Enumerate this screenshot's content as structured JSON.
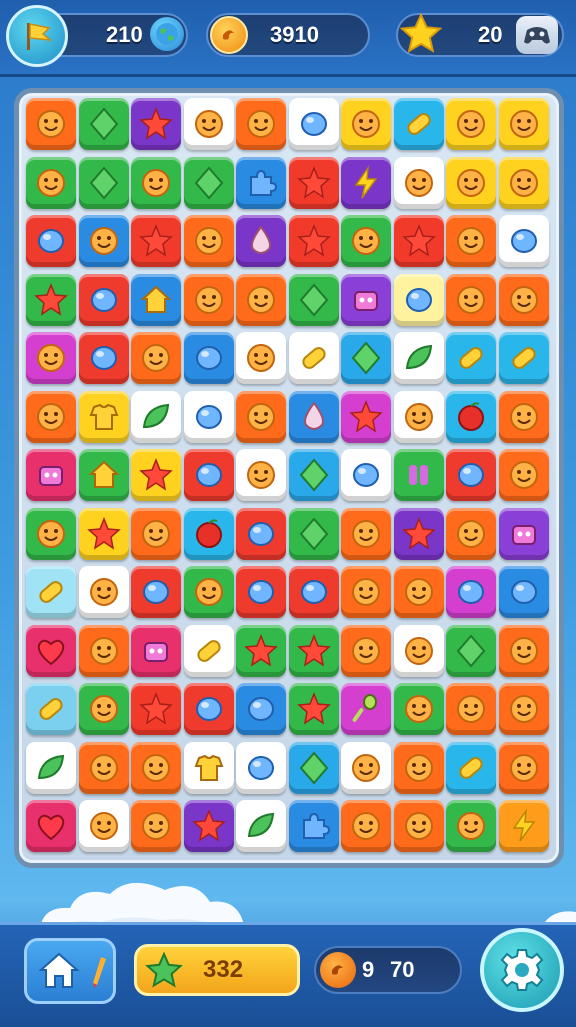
{
  "topbar": {
    "level": {
      "value": "210",
      "icon": "flag-icon",
      "badge_icon": "globe-icon"
    },
    "coins": {
      "value": "3910",
      "icon": "coin-icon"
    },
    "stars": {
      "value": "20",
      "icon": "star-icon",
      "badge_icon": "gamepad-icon"
    }
  },
  "bottombar": {
    "home": {
      "icon": "home-icon",
      "accent_icon": "pencil-icon"
    },
    "score": {
      "value": "332",
      "icon": "star-icon"
    },
    "coins": {
      "value": "9",
      "secondary": "70",
      "icon": "coin-icon"
    },
    "settings": {
      "icon": "gear-icon"
    }
  },
  "board": {
    "columns": 10,
    "rows": 13,
    "tiles": [
      [
        "orange-face",
        "green-diamond",
        "red-star",
        "white-face",
        "orange-face",
        "blue-gem",
        "yellow-face",
        "yellow-bar",
        "yellow-face",
        "yellow-face"
      ],
      [
        "green-face",
        "green-diamond",
        "green-face",
        "green-diamond",
        "blue-puzzle",
        "orange-star",
        "yellow-bolt",
        "white-face",
        "yellow-face",
        "yellow-face"
      ],
      [
        "red-gem",
        "blue-face",
        "orange-star",
        "orange-face",
        "white-drop",
        "orange-star",
        "green-face",
        "orange-star",
        "orange-face",
        "blue-gem"
      ],
      [
        "green-star",
        "red-gem",
        "yellow-house",
        "orange-face",
        "orange-face",
        "green-diamond",
        "purple-robot",
        "yellow-gem",
        "orange-face",
        "orange-face"
      ],
      [
        "purple-face",
        "red-gem",
        "orange-face",
        "teal-gem",
        "white-face",
        "orange-bar",
        "yellow-diamond",
        "green-leaf",
        "yellow-bar",
        "yellow-bar"
      ],
      [
        "orange-face",
        "yellow-shirt",
        "green-leaf",
        "blue-gem",
        "orange-face",
        "blue-drop",
        "purple-star",
        "white-face",
        "red-ball",
        "orange-face"
      ],
      [
        "red-robot",
        "green-house",
        "blue-star",
        "purple-gem",
        "white-face",
        "yellow-diamond",
        "blue-gem",
        "purple-letters",
        "purple-gem",
        "orange-face"
      ],
      [
        "green-face",
        "blue-star",
        "orange-face",
        "red-ball",
        "purple-gem",
        "green-diamond",
        "orange-face",
        "red-star",
        "orange-face",
        "purple-robot"
      ],
      [
        "blue-bar",
        "white-face",
        "red-gem",
        "green-face",
        "purple-gem",
        "purple-gem",
        "orange-face",
        "orange-face",
        "pink-gem",
        "green-gem"
      ],
      [
        "red-heart",
        "orange-face",
        "red-robot",
        "orange-bar",
        "yellow-star",
        "green-star",
        "orange-face",
        "white-face",
        "green-diamond",
        "orange-face"
      ],
      [
        "green-bar",
        "green-face",
        "orange-star",
        "purple-gem",
        "teal-gem",
        "yellow-star",
        "purple-spoon",
        "green-face",
        "orange-face",
        "orange-face"
      ],
      [
        "green-leaf",
        "orange-face",
        "orange-face",
        "purple-shirt",
        "blue-gem",
        "yellow-diamond",
        "white-face",
        "orange-face",
        "yellow-bar",
        "orange-face"
      ],
      [
        "red-heart",
        "white-face",
        "orange-face",
        "red-star",
        "green-leaf",
        "blue-puzzle",
        "orange-face",
        "orange-face",
        "green-face",
        "green-bolt"
      ]
    ],
    "tile_colors": {
      "orange-face": "#ff6b1a",
      "green-diamond": "#33b84a",
      "red-star": "#7a35c9",
      "white-face": "#ffffff",
      "blue-gem": "#ffffff",
      "yellow-face": "#ffd21f",
      "yellow-bar": "#29b6ea",
      "green-face": "#33b84a",
      "blue-puzzle": "#2a8be3",
      "orange-star": "#f23a2a",
      "yellow-bolt": "#7a35c9",
      "red-gem": "#ef3a2e",
      "blue-face": "#2a8be3",
      "white-drop": "#7a35c9",
      "yellow-house": "#2a8be3",
      "purple-robot": "#8a3fd6",
      "yellow-gem": "#fff3a0",
      "purple-face": "#d43fd0",
      "teal-gem": "#2a8be3",
      "orange-bar": "#ffffff",
      "yellow-diamond": "#29a8ea",
      "green-leaf": "#ffffff",
      "yellow-shirt": "#ffd21f",
      "blue-drop": "#2a8be3",
      "purple-star": "#d43fd0",
      "red-ball": "#29b6ea",
      "red-robot": "#e8306c",
      "green-house": "#33b84a",
      "blue-star": "#ffd21f",
      "purple-gem": "#ef3a2e",
      "purple-letters": "#33b84a",
      "pink-gem": "#d43fd0",
      "green-gem": "#2a8be3",
      "blue-bar": "#9fe3f5",
      "red-heart": "#e8306c",
      "yellow-star": "#33b84a",
      "green-star": "#33b84a",
      "purple-spoon": "#d43fd0",
      "purple-shirt": "#ffffff",
      "green-bar": "#7ad0ee",
      "green-bolt": "#ff9d1a"
    }
  }
}
